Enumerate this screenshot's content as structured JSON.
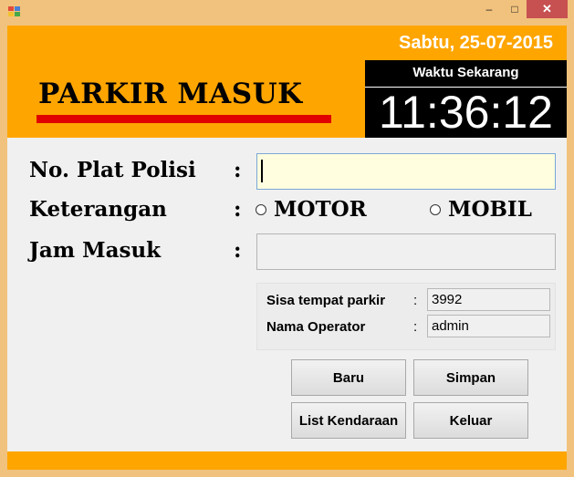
{
  "window": {
    "minimize_glyph": "–",
    "maximize_glyph": "□",
    "close_glyph": "✕"
  },
  "header": {
    "title": "PARKIR MASUK",
    "date": "Sabtu, 25-07-2015",
    "clock_label": "Waktu Sekarang",
    "clock_time": "11:36:12"
  },
  "form": {
    "plate_label": "No. Plat Polisi",
    "info_label": "Keterangan",
    "entry_time_label": "Jam Masuk",
    "colon": ":",
    "plate_value": "",
    "entry_time_value": "",
    "vehicle_options": [
      "MOTOR",
      "MOBIL"
    ]
  },
  "info": {
    "remaining_label": "Sisa tempat parkir",
    "remaining_value": "3992",
    "operator_label": "Nama Operator",
    "operator_value": "admin",
    "colon": ":"
  },
  "buttons": {
    "new": "Baru",
    "save": "Simpan",
    "vehicle_list": "List Kendaraan",
    "exit": "Keluar"
  },
  "colors": {
    "accent": "#ffa500",
    "underline": "#e00000",
    "clock_bg": "#000000",
    "plate_field": "#ffffe0"
  }
}
